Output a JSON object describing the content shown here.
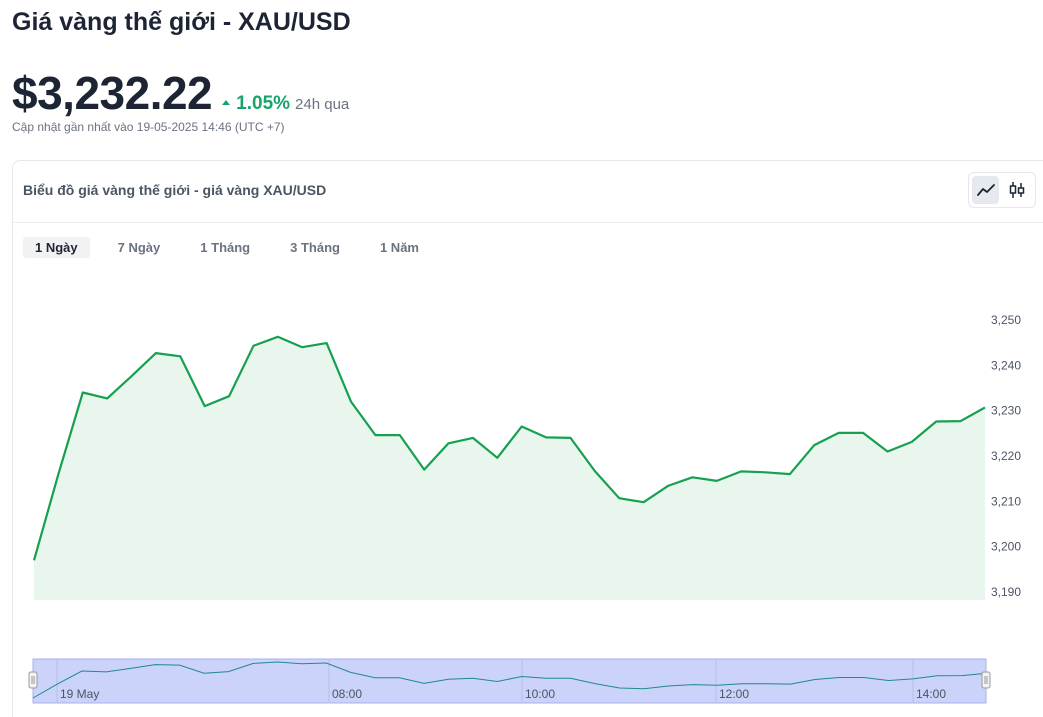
{
  "page": {
    "title": "Giá vàng thế giới - XAU/USD",
    "price": "$3,232.22",
    "change_pct": "1.05%",
    "change_period": "24h qua",
    "updated": "Cập nhật gần nhất vào 19-05-2025 14:46 (UTC +7)"
  },
  "card": {
    "title": "Biểu đồ giá vàng thế giới - giá vàng XAU/USD",
    "chart_types": [
      {
        "name": "line-chart-icon",
        "active": true
      },
      {
        "name": "candlestick-icon",
        "active": false
      }
    ]
  },
  "tabs": [
    {
      "label": "1 Ngày",
      "active": true
    },
    {
      "label": "7 Ngày",
      "active": false
    },
    {
      "label": "1 Tháng",
      "active": false
    },
    {
      "label": "3 Tháng",
      "active": false
    },
    {
      "label": "1 Năm",
      "active": false
    }
  ],
  "colors": {
    "line": "#16a050",
    "area": "#e9f6ee",
    "navigator_fill": "#ccd3fa",
    "navigator_line": "#1f8a8a",
    "up": "#16a46a"
  },
  "chart_data": {
    "type": "area",
    "y_ticks": [
      "3,250",
      "3,240",
      "3,230",
      "3,220",
      "3,210",
      "3,200",
      "3,190"
    ],
    "ylim": [
      3188,
      3256
    ],
    "navigator_labels": [
      "19 May",
      "08:00",
      "10:00",
      "12:00",
      "14:00"
    ],
    "series": [
      {
        "values": [
          3197.0,
          3216.0,
          3234.0,
          3232.7,
          3237.6,
          3242.7,
          3242.0,
          3231.0,
          3233.2,
          3244.3,
          3246.3,
          3244.0,
          3244.9,
          3232.0,
          3224.6,
          3224.6,
          3217.0,
          3222.8,
          3224.0,
          3219.6,
          3226.5,
          3224.1,
          3224.0,
          3216.7,
          3210.7,
          3209.8,
          3213.4,
          3215.3,
          3214.5,
          3216.6,
          3216.4,
          3216.0,
          3222.4,
          3225.1,
          3225.1,
          3221.0,
          3223.1,
          3227.6,
          3227.7,
          3230.7
        ]
      }
    ]
  }
}
